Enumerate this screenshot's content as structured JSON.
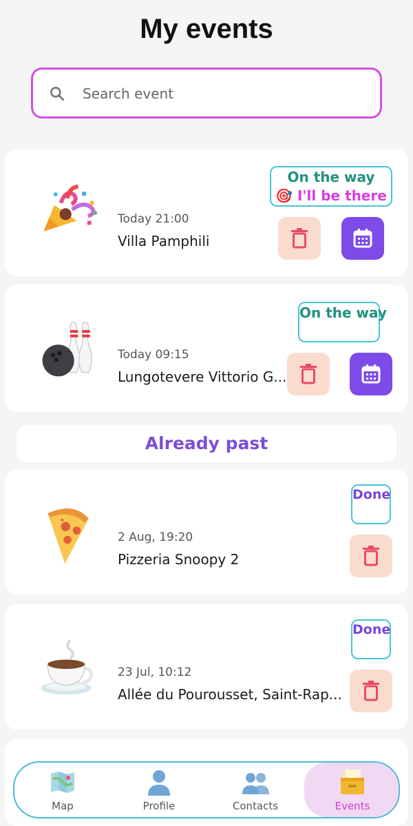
{
  "page_title": "My events",
  "search": {
    "placeholder": "Search event",
    "value": ""
  },
  "upcoming_events": [
    {
      "emoji": "party-popper",
      "when": "Today 21:00",
      "place": "Villa Pamphili",
      "status": [
        "On the way",
        "🎯 I'll be there"
      ]
    },
    {
      "emoji": "bowling",
      "when": "Today 09:15",
      "place": "Lungotevere Vittorio G...",
      "status": [
        "On the way"
      ]
    }
  ],
  "past_section_label": "Already past",
  "past_events": [
    {
      "emoji": "pizza",
      "when": "2 Aug, 19:20",
      "place": "Pizzeria Snoopy 2",
      "status": "Done"
    },
    {
      "emoji": "hot-beverage",
      "when": "23 Jul, 10:12",
      "place": "Allée du Pourousset, Saint-Rap...",
      "status": "Done"
    }
  ],
  "nav": {
    "items": [
      {
        "label": "Map",
        "icon": "map-icon",
        "active": false
      },
      {
        "label": "Profile",
        "icon": "person-icon",
        "active": false
      },
      {
        "label": "Contacts",
        "icon": "people-icon",
        "active": false
      },
      {
        "label": "Events",
        "icon": "card-file-box-icon",
        "active": true
      }
    ]
  },
  "colors": {
    "accent_purple": "#7c4be8",
    "search_border": "#d44fe0",
    "on_the_way": "#23927f",
    "ill_be_there": "#d83ee0",
    "done": "#7a45d6",
    "delete_bg": "#fadccf",
    "delete_icon": "#e84a6a",
    "nav_border": "#4ab9d9"
  }
}
